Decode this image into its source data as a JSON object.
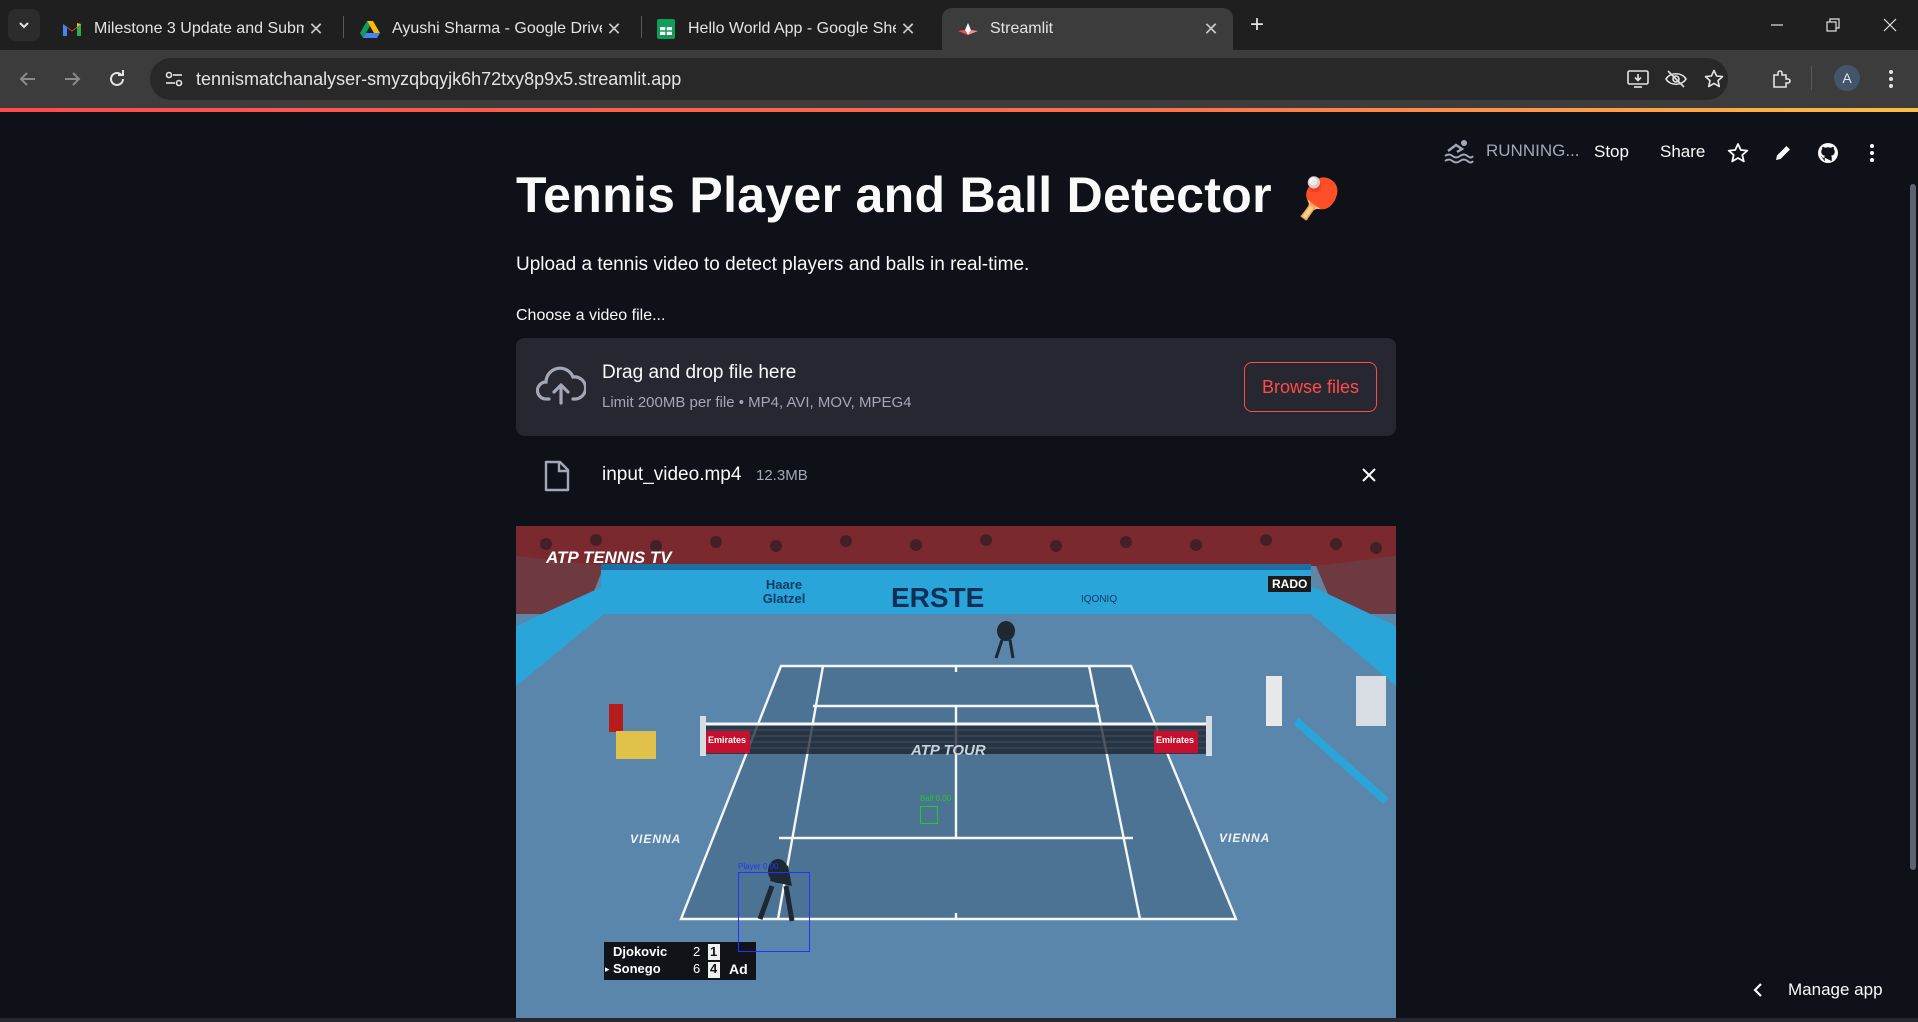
{
  "browser": {
    "tabs": [
      {
        "title": "Milestone 3 Update and Submis",
        "favicon": "gmail-icon"
      },
      {
        "title": "Ayushi Sharma - Google Drive",
        "favicon": "drive-icon"
      },
      {
        "title": "Hello World App - Google Shee",
        "favicon": "sheets-icon"
      },
      {
        "title": "Streamlit",
        "favicon": "streamlit-icon",
        "active": true
      }
    ],
    "url": "tennismatchanalyser-smyzqbqyjk6h72txy8p9x5.streamlit.app",
    "avatar_letter": "A"
  },
  "header": {
    "status": "RUNNING...",
    "stop_label": "Stop",
    "share_label": "Share"
  },
  "main": {
    "title": "Tennis Player and Ball Detector",
    "title_emoji": "🏓",
    "subtitle": "Upload a tennis video to detect players and balls in real-time.",
    "uploader_label": "Choose a video file...",
    "dropzone": {
      "title": "Drag and drop file here",
      "limit": "Limit 200MB per file • MP4, AVI, MOV, MPEG4",
      "browse_label": "Browse files"
    },
    "file": {
      "name": "input_video.mp4",
      "size": "12.3MB"
    }
  },
  "video": {
    "broadcaster": "ATP TENNIS TV",
    "sponsors": [
      "Haare Glatzel",
      "ERSTE",
      "IQONIQ",
      "RADO",
      "Emirates",
      "Emirates",
      "ATP TOUR"
    ],
    "court_text": [
      "VIENNA",
      "VIENNA"
    ],
    "detections": [
      {
        "label": "Ball 0.00",
        "color": "#22cc22"
      },
      {
        "label": "Player 0.00",
        "color": "#2233ff"
      }
    ],
    "score": {
      "players": [
        {
          "name": "Djokovic",
          "set": "2",
          "game": "1",
          "serving": false
        },
        {
          "name": "Sonego",
          "set": "6",
          "game": "4",
          "serving": true
        }
      ],
      "point": "Ad"
    }
  },
  "footer": {
    "manage_label": "Manage app"
  },
  "colors": {
    "accent": "#ff4b4b",
    "background": "#0e1117",
    "dropzone_bg": "#262730",
    "chrome_tabbar": "#1f1f1f",
    "chrome_toolbar": "#3c3c3c"
  }
}
